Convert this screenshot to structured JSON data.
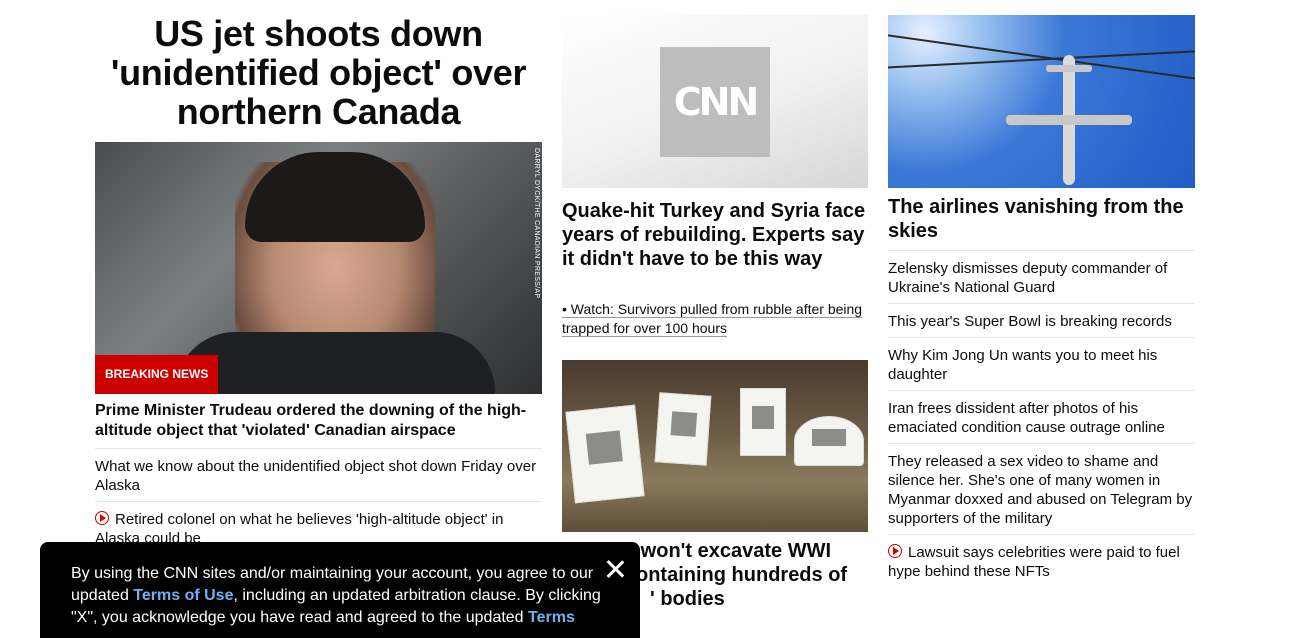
{
  "left": {
    "headline": "US jet shoots down 'unidentified object' over northern Canada",
    "image_credit": "DARRYL DYCK/THE CANADIAN PRESS/AP",
    "badge": "BREAKING NEWS",
    "lead": "Prime Minister Trudeau ordered the downing of the high-altitude object that 'violated' Canadian airspace",
    "items": [
      {
        "text": "What we know about the unidentified object shot down Friday over Alaska",
        "video": false
      },
      {
        "text": "Retired colonel on what he believes 'high-altitude object' in Alaska could be",
        "video": true
      }
    ]
  },
  "middle": {
    "logo_text": "CNN",
    "headline": "Quake-hit Turkey and Syria face years of rebuilding. Experts say it didn't have to be this way",
    "sub": "• Watch: Survivors pulled from rubble after being trapped for over 100 hours",
    "headline2_visible": "y won't excavate WWI\nontaining hundreds of\n' bodies"
  },
  "right": {
    "headline": "The airlines vanishing from the skies",
    "items": [
      {
        "text": "Zelensky dismisses deputy commander of Ukraine's National Guard",
        "video": false
      },
      {
        "text": "This year's Super Bowl is breaking records",
        "video": false
      },
      {
        "text": "Why Kim Jong Un wants you to meet his daughter",
        "video": false
      },
      {
        "text": "Iran frees dissident after photos of his emaciated condition cause outrage online",
        "video": false
      },
      {
        "text": "They released a sex video to shame and silence her. She's one of many women in Myanmar doxxed and abused on Telegram by supporters of the military",
        "video": false
      },
      {
        "text": "Lawsuit says celebrities were paid to fuel hype behind these NFTs",
        "video": true
      }
    ]
  },
  "consent": {
    "text_1": "By using the CNN sites and/or maintaining your account, you agree to our updated ",
    "link_1": "Terms of Use",
    "text_2": ", including an updated arbitration clause. By clicking \"X\", you acknowledge you have read and agreed to the updated ",
    "link_2": "Terms"
  }
}
